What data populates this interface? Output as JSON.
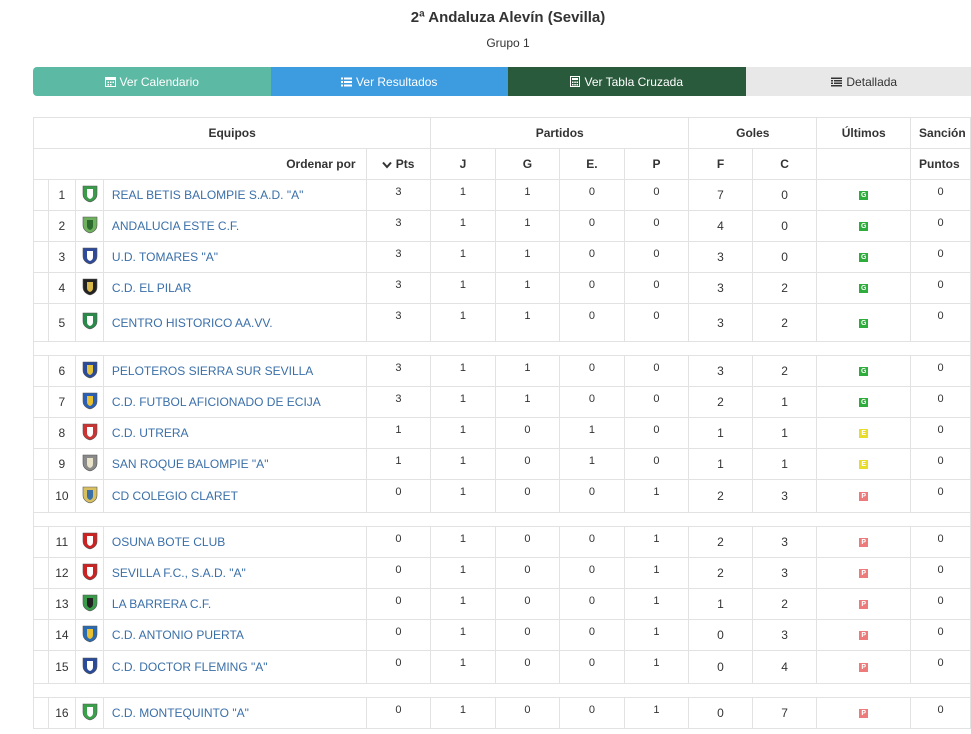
{
  "title": "2ª Andaluza Alevín (Sevilla)",
  "subtitle": "Grupo 1",
  "tabs": [
    "Ver Calendario",
    "Ver Resultados",
    "Ver Tabla Cruzada",
    "Detallada"
  ],
  "headers": {
    "equipos": "Equipos",
    "partidos": "Partidos",
    "goles": "Goles",
    "ultimos": "Últimos",
    "sancion": "Sanción",
    "ordenar": "Ordenar por",
    "pts": "Pts",
    "j": "J",
    "g": "G",
    "e": "E.",
    "p": "P",
    "f": "F",
    "c": "C",
    "puntos": "Puntos"
  },
  "colors": {
    "win": "#2eac3c",
    "draw": "#e7dd2a",
    "loss": "#ed7b7b",
    "link": "#3a6fa8"
  },
  "rows": [
    {
      "pos": "1",
      "team": "REAL BETIS BALOMPIE S.A.D. \"A\"",
      "pts": "3",
      "j": "1",
      "g": "1",
      "e": "0",
      "p": "0",
      "f": "7",
      "c": "0",
      "last": "G",
      "sanc": "0"
    },
    {
      "pos": "2",
      "team": "ANDALUCIA ESTE C.F.",
      "pts": "3",
      "j": "1",
      "g": "1",
      "e": "0",
      "p": "0",
      "f": "4",
      "c": "0",
      "last": "G",
      "sanc": "0"
    },
    {
      "pos": "3",
      "team": "U.D. TOMARES \"A\"",
      "pts": "3",
      "j": "1",
      "g": "1",
      "e": "0",
      "p": "0",
      "f": "3",
      "c": "0",
      "last": "G",
      "sanc": "0"
    },
    {
      "pos": "4",
      "team": "C.D. EL PILAR",
      "pts": "3",
      "j": "1",
      "g": "1",
      "e": "0",
      "p": "0",
      "f": "3",
      "c": "2",
      "last": "G",
      "sanc": "0"
    },
    {
      "pos": "5",
      "team": "CENTRO HISTORICO AA.VV.",
      "pts": "3",
      "j": "1",
      "g": "1",
      "e": "0",
      "p": "0",
      "f": "3",
      "c": "2",
      "last": "G",
      "sanc": "0"
    },
    {
      "pos": "6",
      "team": "PELOTEROS SIERRA SUR SEVILLA",
      "pts": "3",
      "j": "1",
      "g": "1",
      "e": "0",
      "p": "0",
      "f": "3",
      "c": "2",
      "last": "G",
      "sanc": "0"
    },
    {
      "pos": "7",
      "team": "C.D. FUTBOL AFICIONADO DE ECIJA",
      "pts": "3",
      "j": "1",
      "g": "1",
      "e": "0",
      "p": "0",
      "f": "2",
      "c": "1",
      "last": "G",
      "sanc": "0"
    },
    {
      "pos": "8",
      "team": "C.D. UTRERA",
      "pts": "1",
      "j": "1",
      "g": "0",
      "e": "1",
      "p": "0",
      "f": "1",
      "c": "1",
      "last": "E",
      "sanc": "0"
    },
    {
      "pos": "9",
      "team": "SAN ROQUE BALOMPIE \"A\"",
      "pts": "1",
      "j": "1",
      "g": "0",
      "e": "1",
      "p": "0",
      "f": "1",
      "c": "1",
      "last": "E",
      "sanc": "0"
    },
    {
      "pos": "10",
      "team": "CD COLEGIO CLARET",
      "pts": "0",
      "j": "1",
      "g": "0",
      "e": "0",
      "p": "1",
      "f": "2",
      "c": "3",
      "last": "P",
      "sanc": "0"
    },
    {
      "pos": "11",
      "team": "OSUNA BOTE CLUB",
      "pts": "0",
      "j": "1",
      "g": "0",
      "e": "0",
      "p": "1",
      "f": "2",
      "c": "3",
      "last": "P",
      "sanc": "0"
    },
    {
      "pos": "12",
      "team": "SEVILLA F.C., S.A.D. \"A\"",
      "pts": "0",
      "j": "1",
      "g": "0",
      "e": "0",
      "p": "1",
      "f": "2",
      "c": "3",
      "last": "P",
      "sanc": "0"
    },
    {
      "pos": "13",
      "team": "LA BARRERA C.F.",
      "pts": "0",
      "j": "1",
      "g": "0",
      "e": "0",
      "p": "1",
      "f": "1",
      "c": "2",
      "last": "P",
      "sanc": "0"
    },
    {
      "pos": "14",
      "team": "C.D. ANTONIO PUERTA",
      "pts": "0",
      "j": "1",
      "g": "0",
      "e": "0",
      "p": "1",
      "f": "0",
      "c": "3",
      "last": "P",
      "sanc": "0"
    },
    {
      "pos": "15",
      "team": "C.D. DOCTOR FLEMING \"A\"",
      "pts": "0",
      "j": "1",
      "g": "0",
      "e": "0",
      "p": "1",
      "f": "0",
      "c": "4",
      "last": "P",
      "sanc": "0"
    },
    {
      "pos": "16",
      "team": "C.D. MONTEQUINTO \"A\"",
      "pts": "0",
      "j": "1",
      "g": "0",
      "e": "0",
      "p": "1",
      "f": "0",
      "c": "7",
      "last": "P",
      "sanc": "0"
    }
  ]
}
